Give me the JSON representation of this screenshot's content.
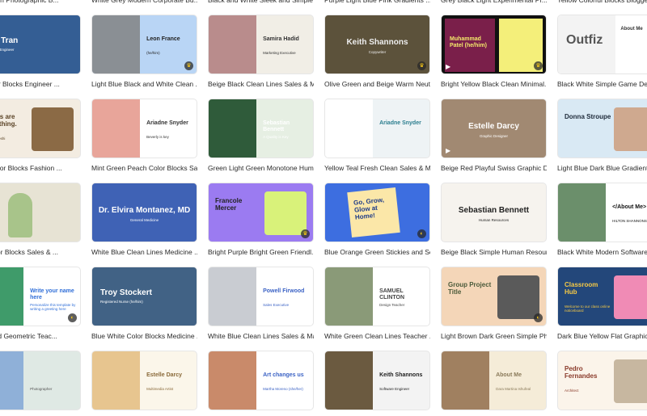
{
  "top_row_labels": [
    "nd Brown Photographic B...",
    "White Grey Modern Corporate Bu...",
    "Black and White Sleek and Simple ...",
    "Purple Light Blue Pink Gradients ...",
    "Grey Black Light Experimental Pr...",
    "Yellow Colorful Blocks Blogger..."
  ],
  "cards": [
    {
      "label": "ite Color Blocks Engineer ...",
      "bg": "#3f6fa8",
      "photo": "#2a4e7f",
      "title": "Neil Tran",
      "sub": "Industrial Engineer",
      "tc": "#ffffff",
      "layout": "center-left"
    },
    {
      "label": "Light Blue Black and White Clean ...",
      "bg": "#b9d5f5",
      "photo": "#8a8f94",
      "title": "Leon France",
      "sub": "(he/him)",
      "tc": "#222222",
      "layout": "photo-left",
      "badge": "crown"
    },
    {
      "label": "Beige Black Clean Lines Sales & M...",
      "bg": "#f1eee6",
      "photo": "#b98c8c",
      "title": "Samira Hadid",
      "sub": "Marketing Executive",
      "tc": "#333333",
      "layout": "photo-left"
    },
    {
      "label": "Olive Green and Beige Warm Neut...",
      "bg": "#4c4632",
      "photo": "#6b5e44",
      "title": "Keith Shannons",
      "sub": "Copywriter",
      "tc": "#eeeeee",
      "layout": "center",
      "badge": "crown"
    },
    {
      "label": "Bright Yellow Black Clean Minimal...",
      "bg": "#111111",
      "photo": "#7a1f4a",
      "title": "Muhammad Patel (he/him)",
      "sub": "",
      "tc": "#f4e96b",
      "layout": "photo-left-yellow",
      "badge": "crown",
      "play": true
    },
    {
      "label": "Black White Simple Game Deve...",
      "bg": "#ffffff",
      "photo": "#f3f3f3",
      "title": "Outfiz",
      "sub": "About Me",
      "tc": "#333333",
      "layout": "logo"
    },
    {
      "label": "own Color Blocks Fashion ...",
      "bg": "#f3ece1",
      "photo": "#8b6a45",
      "title": "Details are everything.",
      "sub": "Sarah Takeshi",
      "tc": "#5a4326",
      "layout": "text-left"
    },
    {
      "label": "Mint Green Peach Color Blocks Sa...",
      "bg": "#ffffff",
      "photo": "#e8a59a",
      "title": "Ariadne Snyder",
      "sub": "Beverly is key",
      "tc": "#333333",
      "layout": "photo-left"
    },
    {
      "label": "Green Light Green Monotone Hum...",
      "bg": "#e6efe3",
      "photo": "#2f5b3a",
      "title": "Sebastian Bennett",
      "sub": "A Quality is Key",
      "tc": "#ffffff",
      "layout": "photo-left"
    },
    {
      "label": "Yellow Teal Fresh Clean Sales & M...",
      "bg": "#eef3f5",
      "photo": "#ffffff",
      "title": "Ariadne Snyder",
      "sub": "",
      "tc": "#2c7e8f",
      "layout": "photo-left"
    },
    {
      "label": "Beige Red Playful Swiss Graphic D...",
      "bg": "#b59c84",
      "photo": "#8d7560",
      "title": "Estelle Darcy",
      "sub": "Graphic Designer",
      "tc": "#ffffff",
      "layout": "center",
      "play": true
    },
    {
      "label": "Light Blue Dark Blue Gradients ...",
      "bg": "#d9e9f4",
      "photo": "#cfa98f",
      "title": "Donna Stroupe",
      "sub": "",
      "tc": "#1e2a3a",
      "layout": "text-left"
    },
    {
      "label": "rey Color Blocks Sales & ...",
      "bg": "#e7e3d4",
      "photo": "#a8c48a",
      "title": "",
      "sub": "",
      "tc": "#333333",
      "layout": "photo-center"
    },
    {
      "label": "White Blue Clean Lines Medicine ...",
      "bg": "#3f62b5",
      "photo": "#3f62b5",
      "title": "Dr. Elvira Montanez, MD",
      "sub": "General Medicine",
      "tc": "#ffffff",
      "layout": "center"
    },
    {
      "label": "Bright Purple Bright Green Friendl...",
      "bg": "#9b7bf1",
      "photo": "#d9f27a",
      "title": "Francole Mercer",
      "sub": "",
      "tc": "#222222",
      "layout": "text-left",
      "badge": "crown"
    },
    {
      "label": "Blue Orange Green Stickies and Sc...",
      "bg": "#3d6ee0",
      "photo": "#fbe7a8",
      "title": "Go, Grow, Glow at Home!",
      "sub": "",
      "tc": "#1f3c88",
      "layout": "sticky",
      "badge": "d"
    },
    {
      "label": "Beige Black Simple Human Resour...",
      "bg": "#f6f3ee",
      "photo": "#f6f3ee",
      "title": "Sebastian Bennett",
      "sub": "Human Resources",
      "tc": "#222222",
      "layout": "center"
    },
    {
      "label": "Black White Modern Software ...",
      "bg": "#ffffff",
      "photo": "#6b8f6b",
      "title": "</About Me>",
      "sub": "HILTON SHANNONS",
      "tc": "#111111",
      "layout": "photo-left"
    },
    {
      "label": "hite Bold Geometric Teac...",
      "bg": "#ffffff",
      "photo": "#3f9b6a",
      "title": "Write your name here",
      "sub": "Personalize this template by writing a greeting here",
      "tc": "#2f6ed8",
      "layout": "photo-left",
      "badge": "d"
    },
    {
      "label": "Blue White Color Blocks Medicine ...",
      "bg": "#36577a",
      "photo": "#4c6d8f",
      "title": "Troy Stockert",
      "sub": "Registered Nurse (he/him)",
      "tc": "#ffffff",
      "layout": "center-left"
    },
    {
      "label": "White Blue Clean Lines Sales & Ma...",
      "bg": "#ffffff",
      "photo": "#c9ccd2",
      "title": "Powell Firwood",
      "sub": "Sales Executive",
      "tc": "#3c63c5",
      "layout": "photo-left"
    },
    {
      "label": "White Green Clean Lines Teacher ...",
      "bg": "#ffffff",
      "photo": "#8a9a78",
      "title": "SAMUEL CLINTON",
      "sub": "Design Teacher",
      "tc": "#444444",
      "layout": "photo-left"
    },
    {
      "label": "Light Brown Dark Green Simple Ph...",
      "bg": "#f4d6b8",
      "photo": "#5a5a5a",
      "title": "Group Project Title",
      "sub": "",
      "tc": "#4a5a3a",
      "layout": "text-left",
      "badge": "d"
    },
    {
      "label": "Dark Blue Yellow Flat Graphic C...",
      "bg": "#23477a",
      "photo": "#f08bb5",
      "title": "Classroom Hub",
      "sub": "Welcome to our class online noticeboard",
      "tc": "#f6c945",
      "layout": "text-left"
    },
    {
      "label": "",
      "bg": "#dfe9e4",
      "photo": "#8fb0d8",
      "title": "",
      "sub": "Photographer",
      "tc": "#555555",
      "layout": "photo-left"
    },
    {
      "label": "",
      "bg": "#fbf6ea",
      "photo": "#e7c58f",
      "title": "Estelle Darcy",
      "sub": "Multimedia Artist",
      "tc": "#8a6a3a",
      "layout": "photo-left"
    },
    {
      "label": "",
      "bg": "#ffffff",
      "photo": "#c98a6a",
      "title": "Art changes us",
      "sub": "Martha Moreno (she/her)",
      "tc": "#3c63c5",
      "layout": "photo-left"
    },
    {
      "label": "",
      "bg": "#f3f3f3",
      "photo": "#6b5a40",
      "title": "Keith Shannons",
      "sub": "Software Engineer",
      "tc": "#222222",
      "layout": "photo-left"
    },
    {
      "label": "",
      "bg": "#f5ecd8",
      "photo": "#a08060",
      "title": "About Me",
      "sub": "Dara Martina Ishufeal",
      "tc": "#8a7a5a",
      "layout": "photo-left"
    },
    {
      "label": "",
      "bg": "#fbf4ea",
      "photo": "#c7b7a0",
      "title": "Pedro Fernandes",
      "sub": "Architect",
      "tc": "#8a3a2a",
      "layout": "text-left"
    }
  ]
}
